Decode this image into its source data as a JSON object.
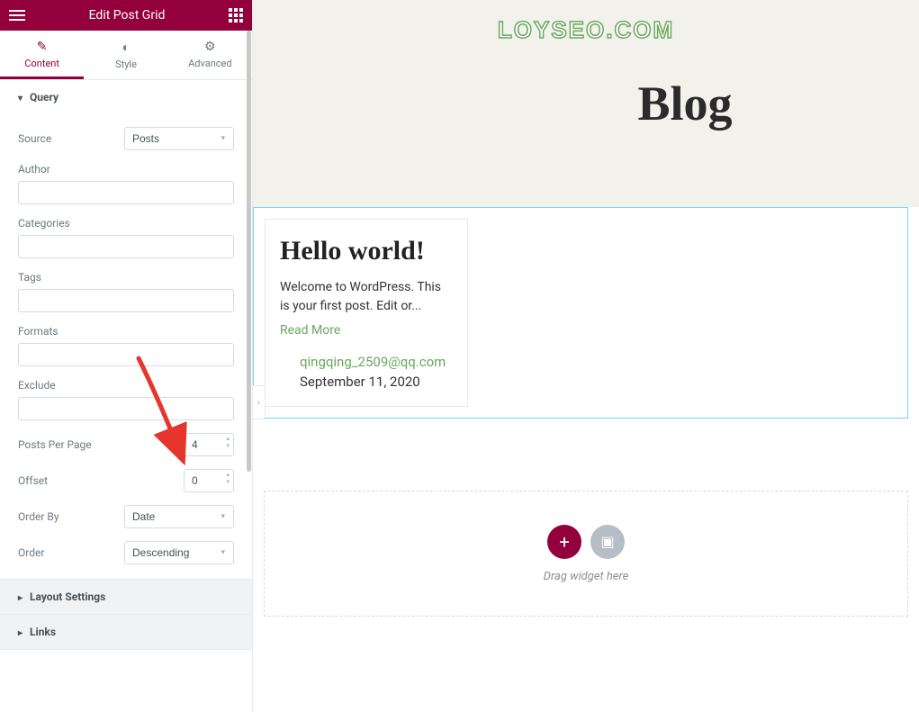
{
  "header": {
    "title": "Edit Post Grid"
  },
  "tabs": {
    "content": "Content",
    "style": "Style",
    "advanced": "Advanced"
  },
  "sections": {
    "query": {
      "title": "Query",
      "source": {
        "label": "Source",
        "value": "Posts"
      },
      "author": {
        "label": "Author",
        "value": ""
      },
      "categories": {
        "label": "Categories",
        "value": ""
      },
      "tags": {
        "label": "Tags",
        "value": ""
      },
      "formats": {
        "label": "Formats",
        "value": ""
      },
      "exclude": {
        "label": "Exclude",
        "value": ""
      },
      "posts_per_page": {
        "label": "Posts Per Page",
        "value": "4"
      },
      "offset": {
        "label": "Offset",
        "value": "0"
      },
      "order_by": {
        "label": "Order By",
        "value": "Date"
      },
      "order": {
        "label": "Order",
        "value": "Descending"
      }
    },
    "layout_settings": {
      "title": "Layout Settings"
    },
    "links": {
      "title": "Links"
    }
  },
  "preview": {
    "watermark": "LOYSEO.COM",
    "hero_title": "Blog",
    "post": {
      "title": "Hello world!",
      "excerpt": "Welcome to WordPress. This is your first post. Edit or...",
      "read_more": "Read More",
      "author": "qingqing_2509@qq.com",
      "date": "September 11, 2020"
    },
    "drop_zone": "Drag widget here"
  },
  "colors": {
    "accent": "#93003c",
    "highlight": "#71d7f7",
    "link": "#6aa85f"
  }
}
